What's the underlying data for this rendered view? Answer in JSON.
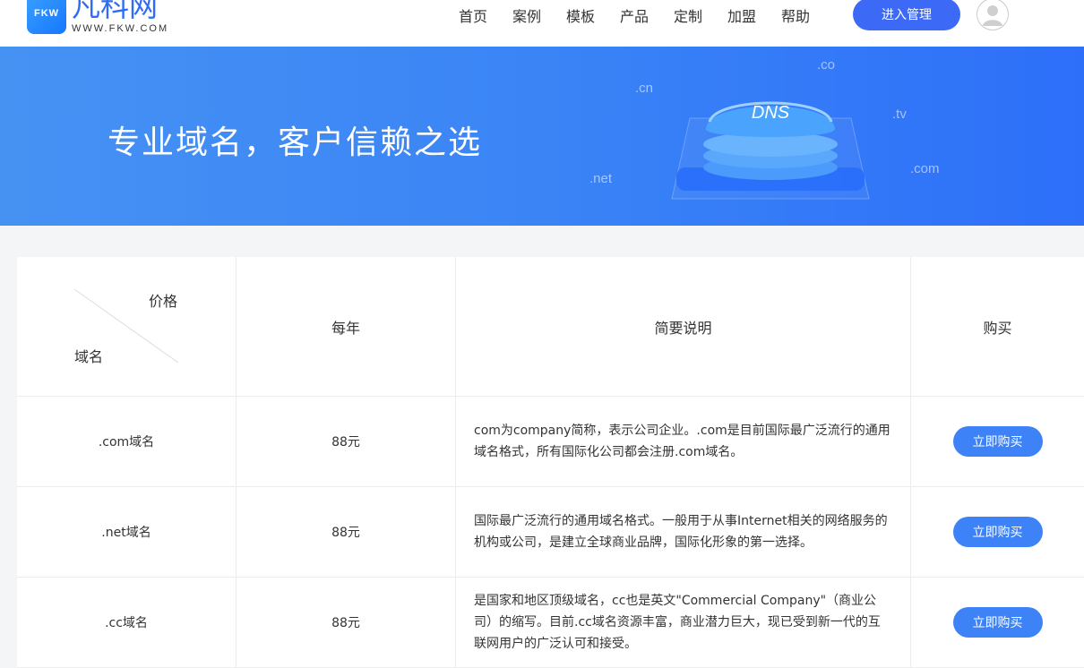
{
  "header": {
    "logo_badge": "FKW",
    "logo_name": "凡科网",
    "logo_url": "WWW.FKW.COM",
    "nav": [
      "首页",
      "案例",
      "模板",
      "产品",
      "定制",
      "加盟",
      "帮助"
    ],
    "manage_button": "进入管理"
  },
  "banner": {
    "title": "专业域名，客户信赖之选",
    "dns_label": "DNS",
    "tlds": [
      ".co",
      ".cn",
      ".tv",
      ".com",
      ".net"
    ]
  },
  "table": {
    "header": {
      "price_label": "价格",
      "domain_label": "域名",
      "yearly": "每年",
      "description": "简要说明",
      "buy": "购买"
    },
    "rows": [
      {
        "domain": ".com域名",
        "price": "88元",
        "description": "com为company简称，表示公司企业。.com是目前国际最广泛流行的通用域名格式，所有国际化公司都会注册.com域名。",
        "button": "立即购买"
      },
      {
        "domain": ".net域名",
        "price": "88元",
        "description": "国际最广泛流行的通用域名格式。一般用于从事Internet相关的网络服务的机构或公司，是建立全球商业品牌，国际化形象的第一选择。",
        "button": "立即购买"
      },
      {
        "domain": ".cc域名",
        "price": "88元",
        "description": "是国家和地区顶级域名，cc也是英文\"Commercial Company\"（商业公司）的缩写。目前.cc域名资源丰富，商业潜力巨大，现已受到新一代的互联网用户的广泛认可和接受。",
        "button": "立即购买"
      }
    ]
  }
}
